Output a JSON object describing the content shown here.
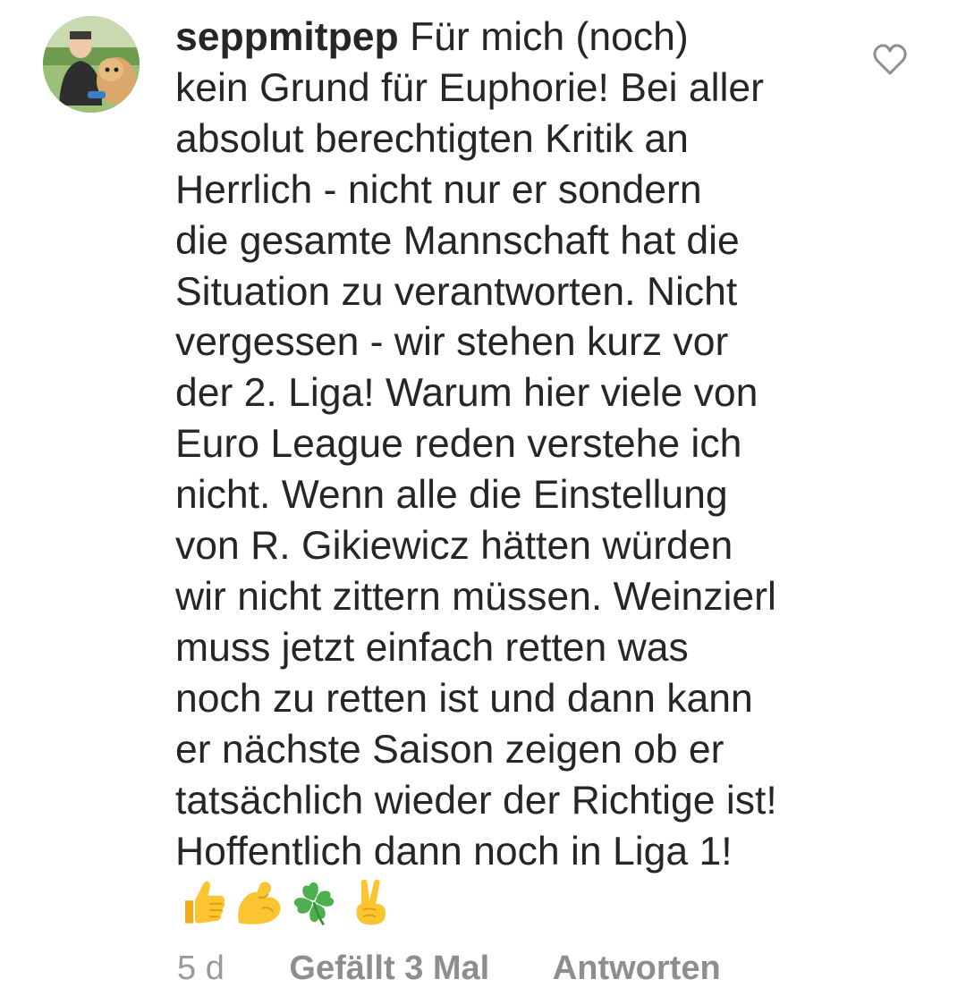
{
  "comment": {
    "username": "seppmitpep",
    "text_lines": [
      "Für mich (noch)",
      "kein Grund für Euphorie! Bei aller",
      "absolut berechtigten Kritik an",
      "Herrlich - nicht nur er sondern",
      "die gesamte Mannschaft hat die",
      "Situation zu verantworten. Nicht",
      "vergessen - wir stehen kurz vor",
      "der 2. Liga! Warum hier viele von",
      "Euro League reden verstehe ich",
      "nicht. Wenn alle die Einstellung",
      "von R. Gikiewicz hätten würden",
      "wir nicht zittern müssen. Weinzierl",
      "muss jetzt einfach retten was",
      "noch zu retten ist und dann kann",
      "er nächste Saison zeigen ob er",
      "tatsächlich wieder der Richtige ist!",
      "Hoffentlich dann noch in Liga 1!"
    ],
    "emojis": [
      "thumbs-up",
      "flexed-biceps",
      "four-leaf-clover",
      "victory-hand"
    ],
    "age": "5 d",
    "likes_label": "Gefällt 3 Mal",
    "reply_label": "Antworten"
  },
  "icons": {
    "like": "heart-outline-icon",
    "avatar": "user-avatar-photo"
  },
  "colors": {
    "text": "#262626",
    "meta": "#8e8e8e",
    "heart_stroke": "#8e8e8e",
    "emoji_yellow": "#fbc531",
    "clover_green": "#4caf50"
  }
}
